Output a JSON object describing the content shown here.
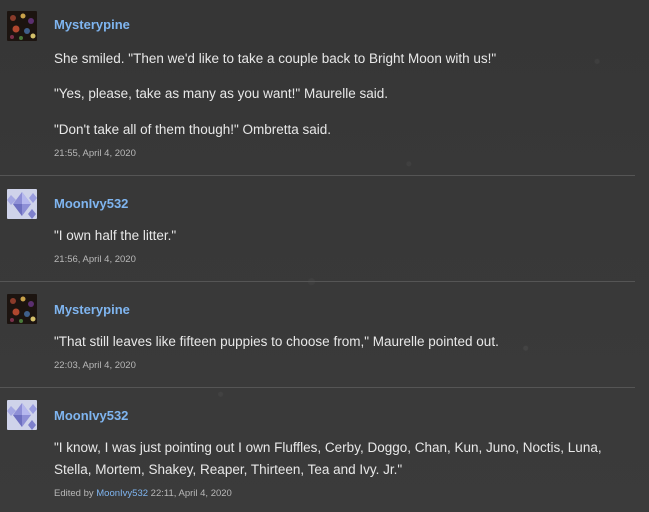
{
  "posts": [
    {
      "username": "Mysterypine",
      "avatar_icon": "dark-spotted-avatar",
      "lines": [
        "She smiled. \"Then we'd like to take a couple back to Bright Moon with us!\"",
        "\"Yes, please, take as many as you want!\" Maurelle said.",
        "\"Don't take all of them though!\" Ombretta said."
      ],
      "timestamp": "21:55, April 4, 2020"
    },
    {
      "username": "MoonIvy532",
      "avatar_icon": "crystal-diamond-avatar",
      "lines": [
        "\"I own half the litter.\""
      ],
      "timestamp": "21:56, April 4, 2020"
    },
    {
      "username": "Mysterypine",
      "avatar_icon": "dark-spotted-avatar",
      "lines": [
        "\"That still leaves like fifteen puppies to choose from,\" Maurelle pointed out."
      ],
      "timestamp": "22:03, April 4, 2020"
    },
    {
      "username": "MoonIvy532",
      "avatar_icon": "crystal-diamond-avatar",
      "lines": [
        "\"I know, I was just pointing out I own Fluffles, Cerby, Doggo, Chan, Kun, Juno, Noctis, Luna,",
        "Stella, Mortem, Shakey, Reaper, Thirteen, Tea and Ivy. Jr.\""
      ],
      "edited_prefix": "Edited by",
      "edited_by": "MoonIvy532",
      "timestamp": "22:11, April 4, 2020"
    }
  ],
  "colors": {
    "username": "#7fb5f0",
    "text": "#e8e8e8",
    "meta": "#b8b8b8",
    "divider": "#555555",
    "background": "#3a3a3a"
  }
}
